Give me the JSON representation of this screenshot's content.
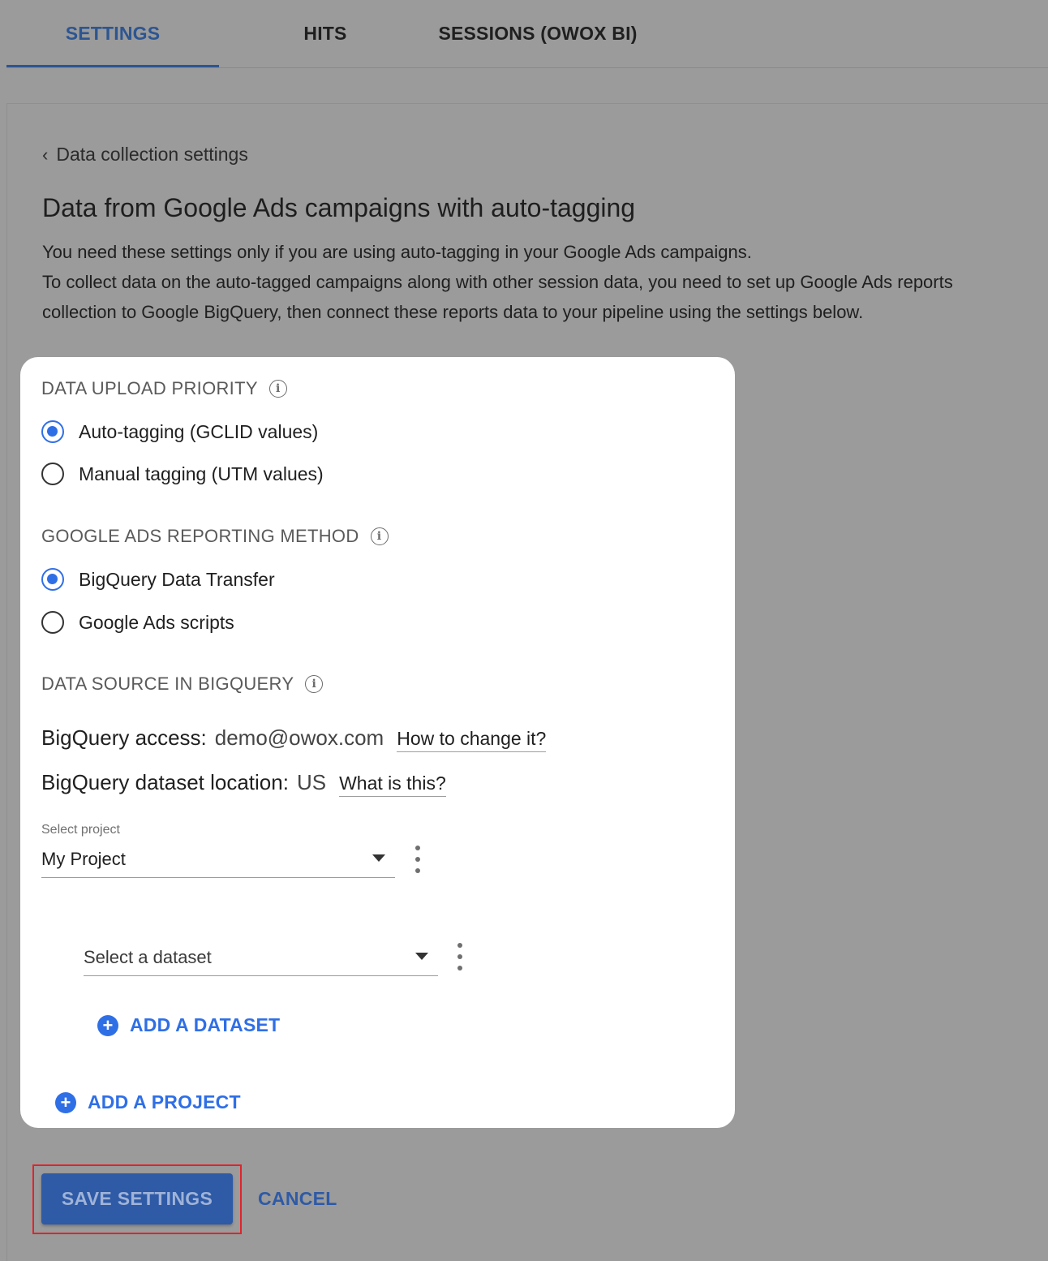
{
  "tabs": [
    {
      "label": "SETTINGS",
      "active": true
    },
    {
      "label": "HITS",
      "active": false
    },
    {
      "label": "SESSIONS (OWOX BI)",
      "active": false
    }
  ],
  "breadcrumb": {
    "label": "Data collection settings"
  },
  "page_title": "Data from Google Ads campaigns with auto-tagging",
  "description": {
    "line1": "You need these settings only if you are using auto-tagging in your Google Ads campaigns.",
    "line2": "To collect data on the auto-tagged campaigns along with other session data, you need to set up Google Ads reports collection to Google BigQuery, then connect these reports data to your pipeline using the settings below."
  },
  "priority": {
    "label": "DATA UPLOAD PRIORITY",
    "options": [
      {
        "label": "Auto-tagging (GCLID values)",
        "checked": true
      },
      {
        "label": "Manual tagging (UTM values)",
        "checked": false
      }
    ]
  },
  "reporting": {
    "label": "GOOGLE ADS REPORTING METHOD",
    "options": [
      {
        "label": "BigQuery Data Transfer",
        "checked": true
      },
      {
        "label": "Google Ads scripts",
        "checked": false
      }
    ]
  },
  "source": {
    "label": "DATA SOURCE IN BIGQUERY",
    "access_label": "BigQuery access:",
    "access_value": "demo@owox.com",
    "access_link": "How to change it?",
    "location_label": "BigQuery dataset location:",
    "location_value": "US",
    "location_link": "What is this?"
  },
  "project": {
    "caption": "Select project",
    "value": "My Project"
  },
  "dataset": {
    "placeholder": "Select a dataset"
  },
  "add_dataset_label": "ADD A DATASET",
  "add_project_label": "ADD A PROJECT",
  "footer": {
    "save_label": "SAVE SETTINGS",
    "cancel_label": "CANCEL"
  },
  "colors": {
    "accent": "#2f6fe6",
    "primary_button": "#2e5aa6",
    "highlight_border": "#e0242b"
  }
}
